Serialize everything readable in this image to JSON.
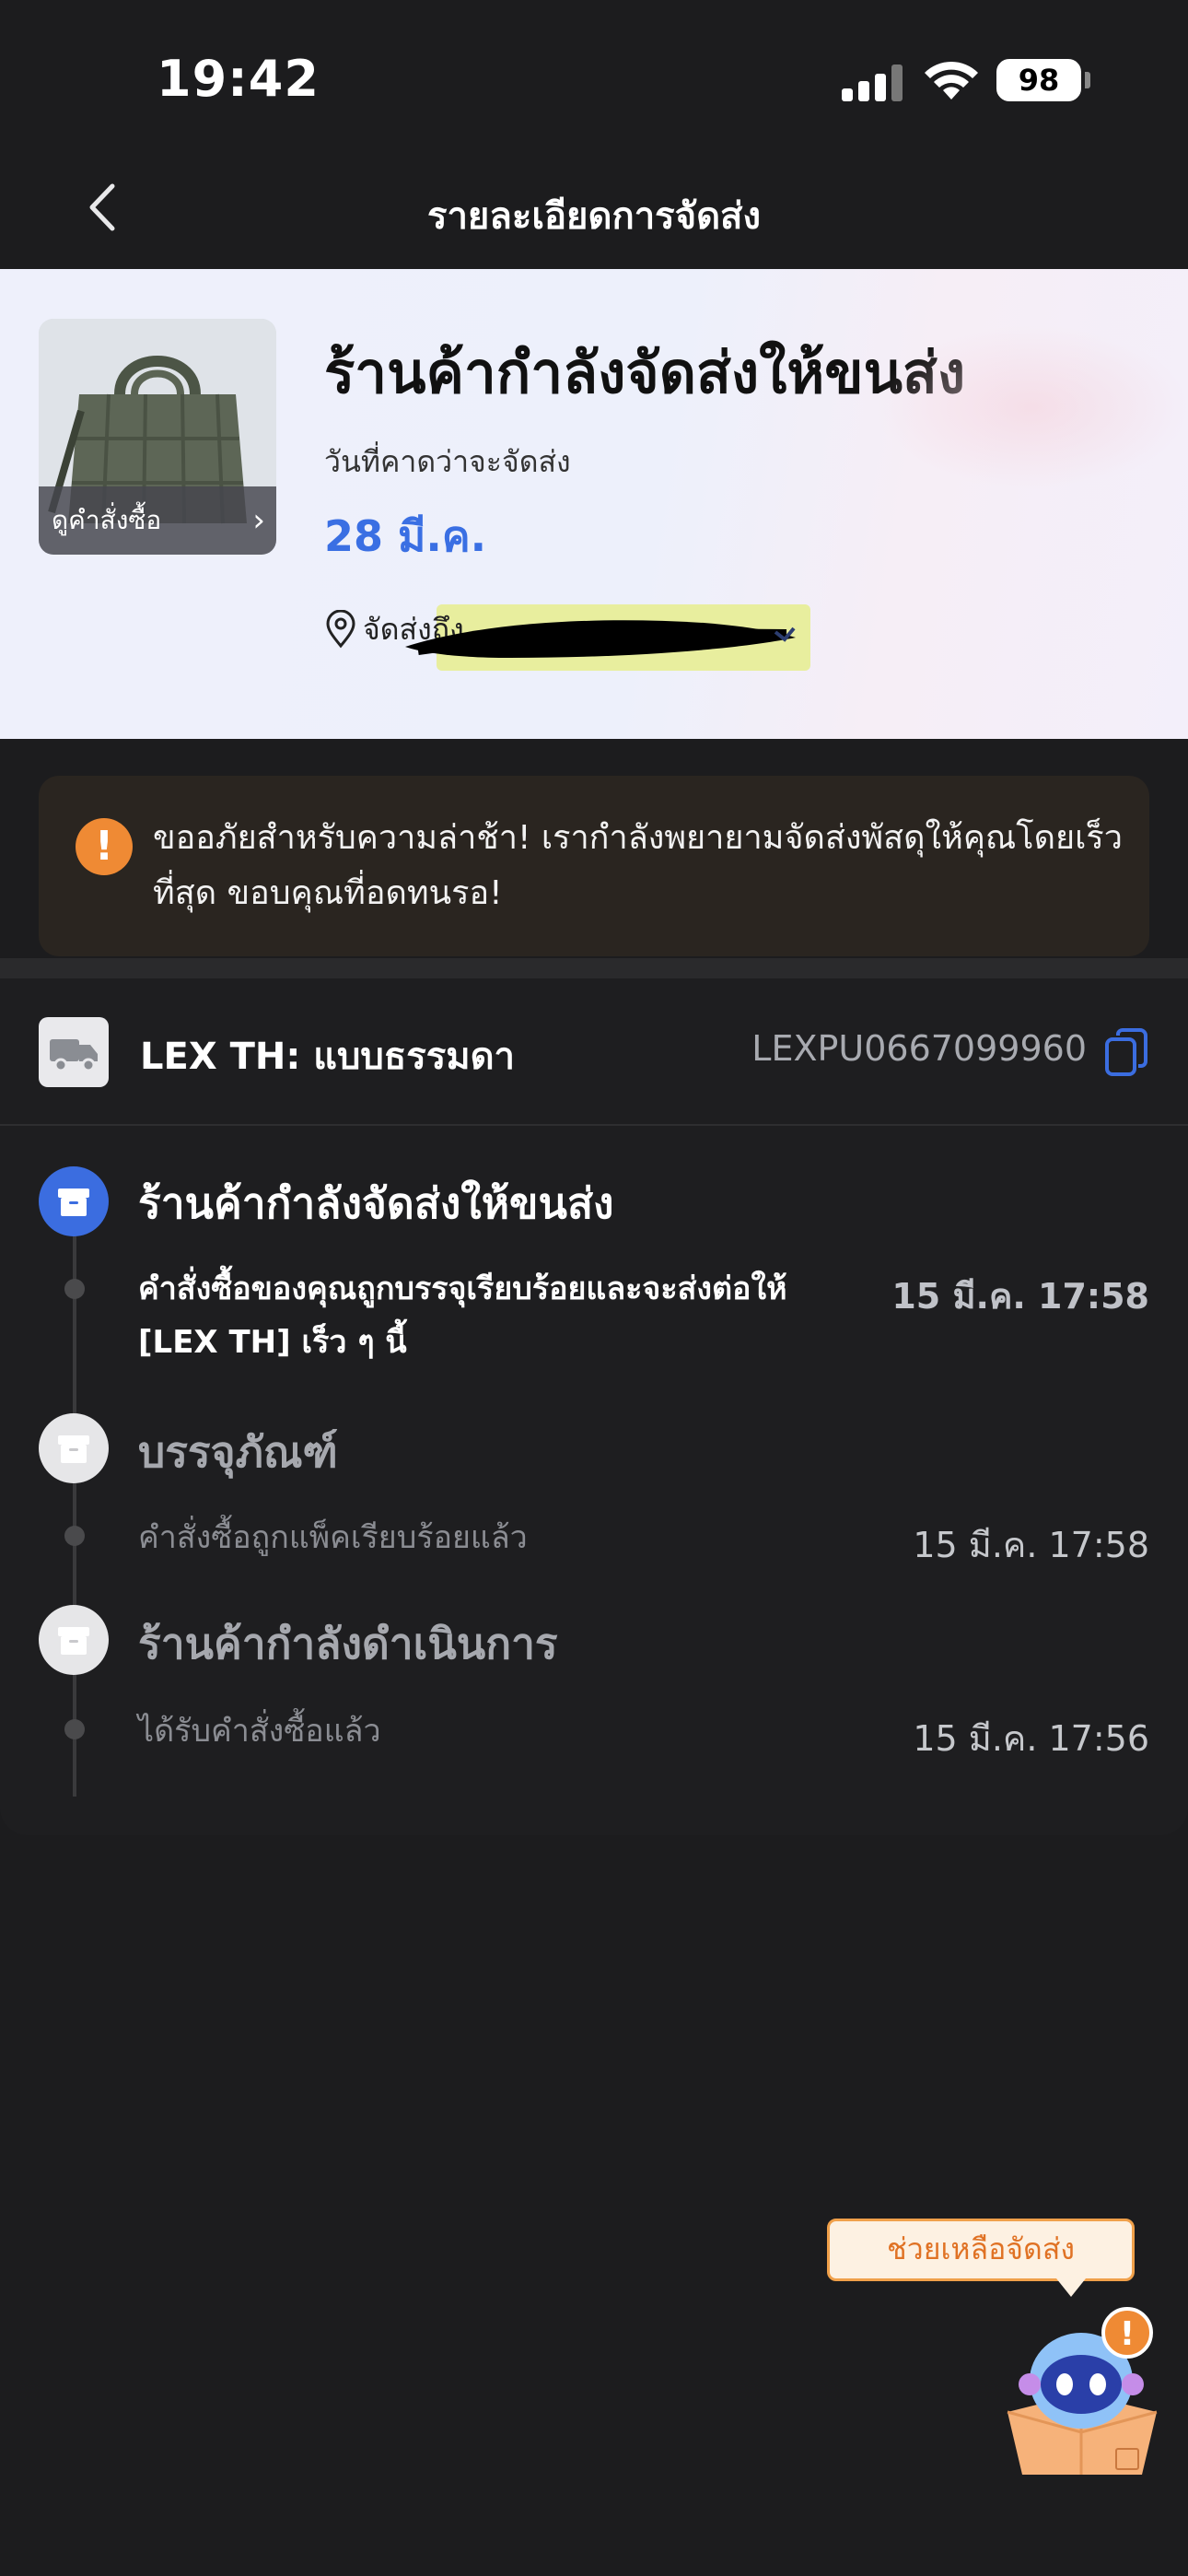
{
  "status_bar": {
    "time": "19:42",
    "battery": "98"
  },
  "nav": {
    "title": "รายละเอียดการจัดส่ง"
  },
  "header": {
    "title": "ร้านค้ากำลังจัดส่งให้ขนส่ง",
    "product_link_label": "ดูคำสั่งซื้อ",
    "eta_label": "วันที่คาดว่าจะจัดส่ง",
    "eta_date": "28 มี.ค.",
    "ship_to_label": "จัดส่งถึง"
  },
  "alert": {
    "icon": "!",
    "text": "ขออภัยสำหรับความล่าช้า! เรากำลังพยายามจัดส่งพัสดุให้คุณโดยเร็วที่สุด ขอบคุณที่อดทนรอ!"
  },
  "carrier": {
    "name": "LEX TH: แบบธรรมดา",
    "tracking_number": "LEXPU0667099960"
  },
  "timeline": [
    {
      "title": "ร้านค้ากำลังจัดส่งให้ขนส่ง",
      "description": "คำสั่งซื้อของคุณถูกบรรจุเรียบร้อยและจะส่งต่อให้ [LEX TH] เร็ว ๆ นี้",
      "time": "15 มี.ค. 17:58",
      "state": "active"
    },
    {
      "title": "บรรจุภัณฑ์",
      "description": "คำสั่งซื้อถูกแพ็คเรียบร้อยแล้ว",
      "time": "15 มี.ค. 17:58",
      "state": "done"
    },
    {
      "title": "ร้านค้ากำลังดำเนินการ",
      "description": "ได้รับคำสั่งซื้อแล้ว",
      "time": "15 มี.ค. 17:56",
      "state": "done"
    }
  ],
  "help": {
    "label": "ช่วยเหลือจัดส่ง",
    "badge": "!"
  },
  "colors": {
    "accent": "#3a6fe3",
    "alert": "#ef8a34",
    "background": "#1c1c1e"
  }
}
